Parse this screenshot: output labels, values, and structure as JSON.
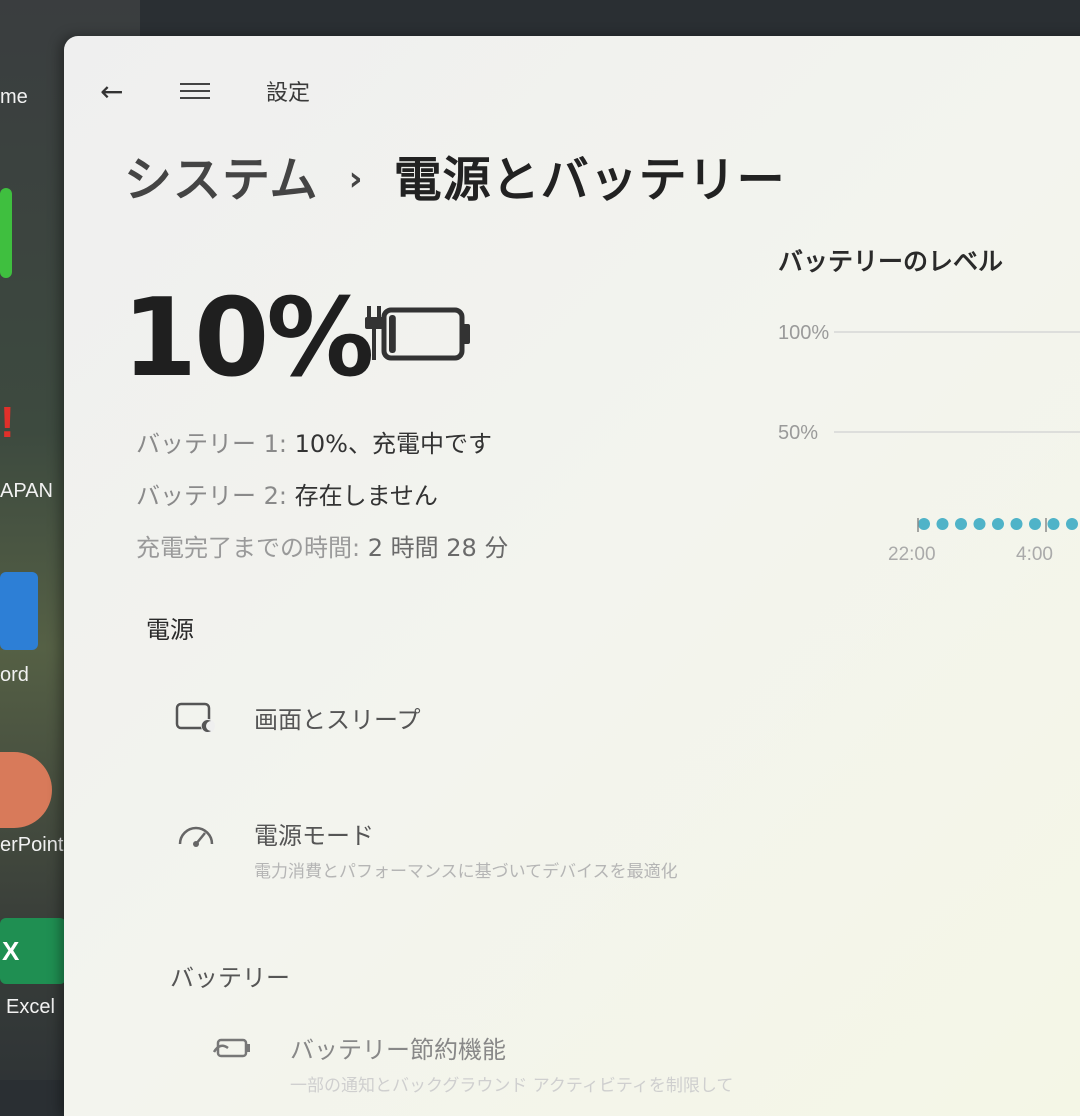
{
  "desktop": {
    "labels": [
      "me",
      "APAN",
      "ord",
      "erPoint",
      "Excel"
    ],
    "exclaim": "!",
    "excel_icon_letter": "X"
  },
  "nav": {
    "back_icon": "back-arrow-icon",
    "menu_icon": "hamburger-menu-icon",
    "app_title": "設定"
  },
  "breadcrumb": {
    "parent": "システム",
    "separator": "›",
    "current": "電源とバッテリー"
  },
  "battery": {
    "percent_text": "10%",
    "level": 0.1,
    "charging": true,
    "icon": "battery-charging-icon",
    "lines": [
      {
        "label": "バッテリー 1:",
        "value": "10%、充電中です"
      },
      {
        "label": "バッテリー 2:",
        "value": "存在しません"
      },
      {
        "label": "充電完了までの時間:",
        "value": "2 時間 28 分"
      }
    ]
  },
  "sections": {
    "power": {
      "heading": "電源",
      "items": [
        {
          "icon": "screen-sleep-icon",
          "title": "画面とスリープ",
          "subtitle": ""
        },
        {
          "icon": "power-mode-gauge-icon",
          "title": "電源モード",
          "subtitle": "電力消費とパフォーマンスに基づいてデバイスを最適化"
        }
      ]
    },
    "battery": {
      "heading": "バッテリー",
      "items": [
        {
          "icon": "battery-saver-icon",
          "title": "バッテリー節約機能",
          "subtitle": "一部の通知とバックグラウンド アクティビティを制限して"
        }
      ]
    }
  },
  "chart_data": {
    "type": "scatter",
    "title": "バッテリーのレベル",
    "y_ticks": [
      "100%",
      "50%"
    ],
    "x_ticks": [
      "22:00",
      "4:00"
    ],
    "series": [
      {
        "values": [
          0.03,
          0.03,
          0.03,
          0.03,
          0.03,
          0.03,
          0.03,
          0.03,
          0.03,
          0.03,
          0.03,
          0.03,
          0.03,
          0.03,
          0.03
        ]
      }
    ],
    "ylim": [
      0,
      1
    ],
    "grid": true,
    "colors": {
      "points": "#4fb3c8",
      "grid": "#d6d6d6"
    }
  }
}
